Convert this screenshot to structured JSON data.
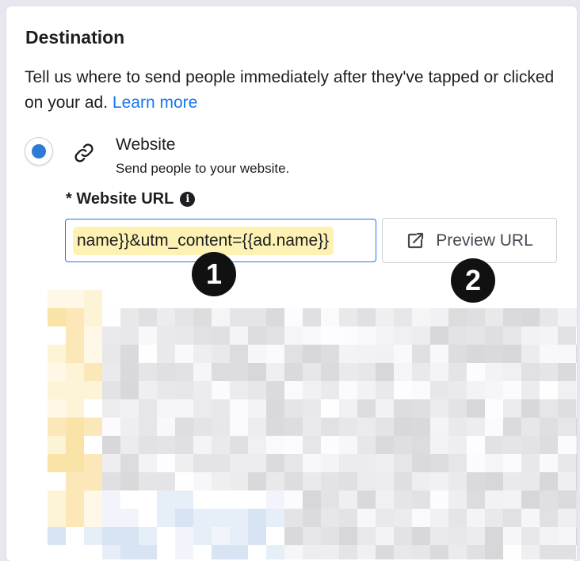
{
  "section": {
    "title": "Destination",
    "description": "Tell us where to send people immediately after they've tapped or clicked on your ad.",
    "learn_more": "Learn more"
  },
  "option": {
    "title": "Website",
    "subtitle": "Send people to your website.",
    "selected": true
  },
  "website_url": {
    "label": "* Website URL",
    "value": "name}}&utm_content={{ad.name}}"
  },
  "preview_button": {
    "label": "Preview URL"
  },
  "annotations": [
    "1",
    "2"
  ],
  "colors": {
    "accent": "#1877f2",
    "radio": "#2d7bd3",
    "highlight": "#fdf1b3"
  },
  "icons": [
    "link-icon",
    "info-icon",
    "external-link-icon"
  ]
}
